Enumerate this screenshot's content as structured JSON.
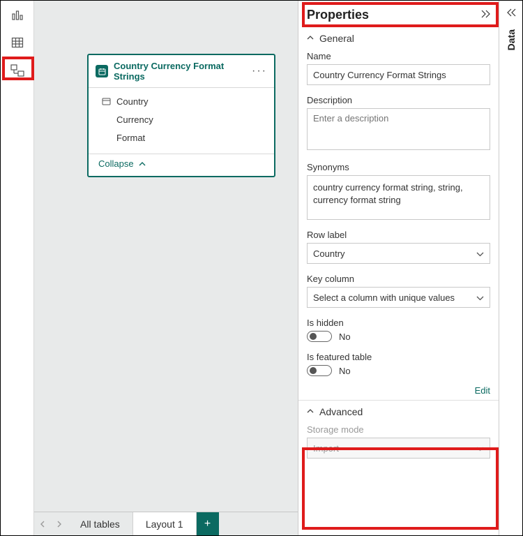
{
  "rail": {
    "report_view": "report-view",
    "data_view": "data-view",
    "model_view": "model-view"
  },
  "table_card": {
    "title": "Country Currency Format Strings",
    "fields": [
      "Country",
      "Currency",
      "Format"
    ],
    "collapse_label": "Collapse"
  },
  "tabs": {
    "all_tables": "All tables",
    "layout1": "Layout 1"
  },
  "properties": {
    "title": "Properties",
    "sections": {
      "general": "General",
      "advanced": "Advanced"
    },
    "name_label": "Name",
    "name_value": "Country Currency Format Strings",
    "description_label": "Description",
    "description_placeholder": "Enter a description",
    "description_value": "",
    "synonyms_label": "Synonyms",
    "synonyms_value": "country currency format string, string, currency format string",
    "row_label_label": "Row label",
    "row_label_value": "Country",
    "key_column_label": "Key column",
    "key_column_placeholder": "Select a column with unique values",
    "is_hidden_label": "Is hidden",
    "is_hidden_value": "No",
    "is_featured_label": "Is featured table",
    "is_featured_value": "No",
    "edit_label": "Edit",
    "storage_mode_label": "Storage mode",
    "storage_mode_value": "Import"
  },
  "data_pane": {
    "title": "Data"
  }
}
